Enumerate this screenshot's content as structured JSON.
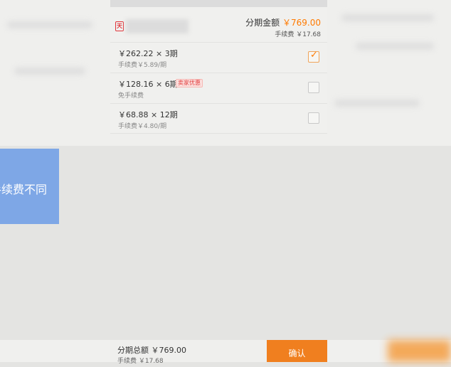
{
  "overlay": {
    "text": "手续费不同"
  },
  "seller": {
    "logo_char": "天"
  },
  "summary": {
    "amount_label": "分期金额",
    "amount_value": "￥769.00",
    "fee_text": "手续费 ￥17.68"
  },
  "options": [
    {
      "main": "￥262.22 × 3期",
      "sub": "手续费￥5.89/期",
      "badge": "",
      "checked": true
    },
    {
      "main": "￥128.16 × 6期",
      "sub": "免手续费",
      "badge": "卖家优惠",
      "checked": false
    },
    {
      "main": "￥68.88 × 12期",
      "sub": "手续费￥4.80/期",
      "badge": "",
      "checked": false
    }
  ],
  "footer": {
    "total_text": "分期总额 ￥769.00",
    "fee_text": "手续费 ￥17.68",
    "confirm_label": "确认"
  },
  "colors": {
    "accent": "#ff7a00",
    "button": "#f07f1f",
    "overlay": "#7ea7e6"
  },
  "icons": {
    "check": "check-icon",
    "seller_logo": "tmall-logo-icon"
  }
}
